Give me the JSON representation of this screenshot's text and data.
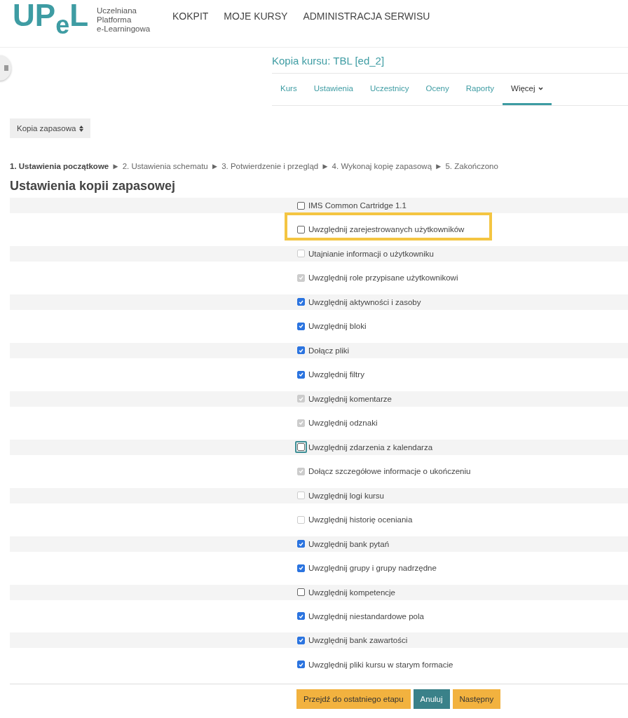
{
  "logo": {
    "letters": [
      "U",
      "P",
      "e",
      "L"
    ],
    "lines": [
      "Uczelniana",
      "Platforma",
      "e-Learningowa"
    ]
  },
  "nav": [
    "KOKPIT",
    "MOJE KURSY",
    "ADMINISTRACJA SERWISU"
  ],
  "course": {
    "title": "Kopia kursu: TBL [ed_2]"
  },
  "tabs": [
    {
      "label": "Kurs",
      "selected": false,
      "dropdown": false
    },
    {
      "label": "Ustawienia",
      "selected": false,
      "dropdown": false
    },
    {
      "label": "Uczestnicy",
      "selected": false,
      "dropdown": false
    },
    {
      "label": "Oceny",
      "selected": false,
      "dropdown": false
    },
    {
      "label": "Raporty",
      "selected": false,
      "dropdown": false
    },
    {
      "label": "Więcej",
      "selected": true,
      "dropdown": true
    }
  ],
  "action_menu": {
    "label": "Kopia zapasowa"
  },
  "steps": [
    {
      "label": "1. Ustawienia początkowe",
      "selected": true
    },
    {
      "label": "2. Ustawienia schematu",
      "selected": false
    },
    {
      "label": "3. Potwierdzenie i przegląd",
      "selected": false
    },
    {
      "label": "4. Wykonaj kopię zapasową",
      "selected": false
    },
    {
      "label": "5. Zakończono",
      "selected": false
    }
  ],
  "step_separator": "►",
  "heading": "Ustawienia kopii zapasowej",
  "options": [
    {
      "label": "IMS Common Cartridge 1.1",
      "checked": false,
      "disabled": false,
      "highlighted": false,
      "focused": false
    },
    {
      "label": "Uwzględnij zarejestrowanych użytkowników",
      "checked": false,
      "disabled": false,
      "highlighted": true,
      "focused": false
    },
    {
      "label": "Utajnianie informacji o użytkowniku",
      "checked": false,
      "disabled": true,
      "highlighted": false,
      "focused": false
    },
    {
      "label": "Uwzględnij role przypisane użytkownikowi",
      "checked": true,
      "disabled": true,
      "highlighted": false,
      "focused": false
    },
    {
      "label": "Uwzględnij aktywności i zasoby",
      "checked": true,
      "disabled": false,
      "highlighted": false,
      "focused": false
    },
    {
      "label": "Uwzględnij bloki",
      "checked": true,
      "disabled": false,
      "highlighted": false,
      "focused": false
    },
    {
      "label": "Dołącz pliki",
      "checked": true,
      "disabled": false,
      "highlighted": false,
      "focused": false
    },
    {
      "label": "Uwzględnij filtry",
      "checked": true,
      "disabled": false,
      "highlighted": false,
      "focused": false
    },
    {
      "label": "Uwzględnij komentarze",
      "checked": true,
      "disabled": true,
      "highlighted": false,
      "focused": false
    },
    {
      "label": "Uwzględnij odznaki",
      "checked": true,
      "disabled": true,
      "highlighted": false,
      "focused": false
    },
    {
      "label": "Uwzględnij zdarzenia z kalendarza",
      "checked": false,
      "disabled": false,
      "highlighted": false,
      "focused": true
    },
    {
      "label": "Dołącz szczegółowe informacje o ukończeniu",
      "checked": true,
      "disabled": true,
      "highlighted": false,
      "focused": false
    },
    {
      "label": "Uwzględnij logi kursu",
      "checked": false,
      "disabled": true,
      "highlighted": false,
      "focused": false
    },
    {
      "label": "Uwzględnij historię oceniania",
      "checked": false,
      "disabled": true,
      "highlighted": false,
      "focused": false
    },
    {
      "label": "Uwzględnij bank pytań",
      "checked": true,
      "disabled": false,
      "highlighted": false,
      "focused": false
    },
    {
      "label": "Uwzględnij grupy i grupy nadrzędne",
      "checked": true,
      "disabled": false,
      "highlighted": false,
      "focused": false
    },
    {
      "label": "Uwzględnij kompetencje",
      "checked": false,
      "disabled": false,
      "highlighted": false,
      "focused": false
    },
    {
      "label": "Uwzględnij niestandardowe pola",
      "checked": true,
      "disabled": false,
      "highlighted": false,
      "focused": false
    },
    {
      "label": "Uwzględnij bank zawartości",
      "checked": true,
      "disabled": false,
      "highlighted": false,
      "focused": false
    },
    {
      "label": "Uwzględnij pliki kursu w starym formacie",
      "checked": true,
      "disabled": false,
      "highlighted": false,
      "focused": false
    }
  ],
  "buttons": [
    {
      "label": "Przejdź do ostatniego etapu",
      "kind": "warning"
    },
    {
      "label": "Anuluj",
      "kind": "primary"
    },
    {
      "label": "Następny",
      "kind": "warning"
    }
  ]
}
